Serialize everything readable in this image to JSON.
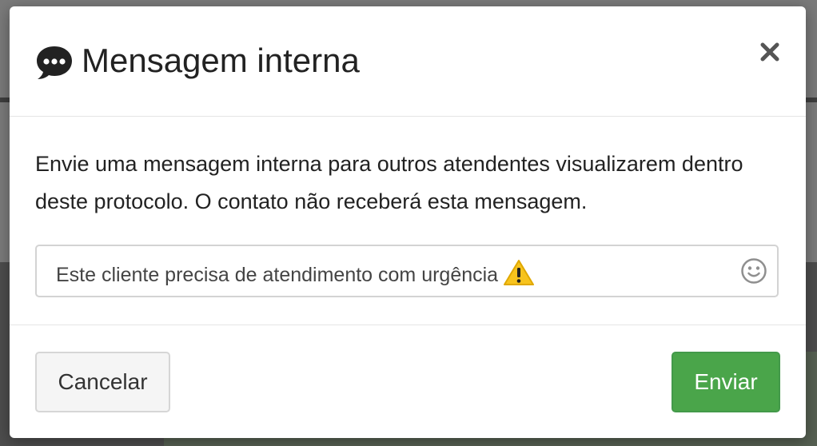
{
  "modal": {
    "title": "Mensagem interna",
    "title_icon": "comment-dots-icon",
    "close_label": "×",
    "description": "Envie uma mensagem interna para outros atendentes visualizarem dentro deste protocolo. O contato não receberá esta mensagem.",
    "message": {
      "value": "Este cliente precisa de atendimento com urgência",
      "trailing_emoji": "warning-icon"
    },
    "emoji_button_icon": "smiley-icon",
    "buttons": {
      "cancel": "Cancelar",
      "send": "Enviar"
    }
  },
  "colors": {
    "primary_button": "#4aa54a",
    "title_text": "#222222",
    "warning": "#f7c31d"
  }
}
